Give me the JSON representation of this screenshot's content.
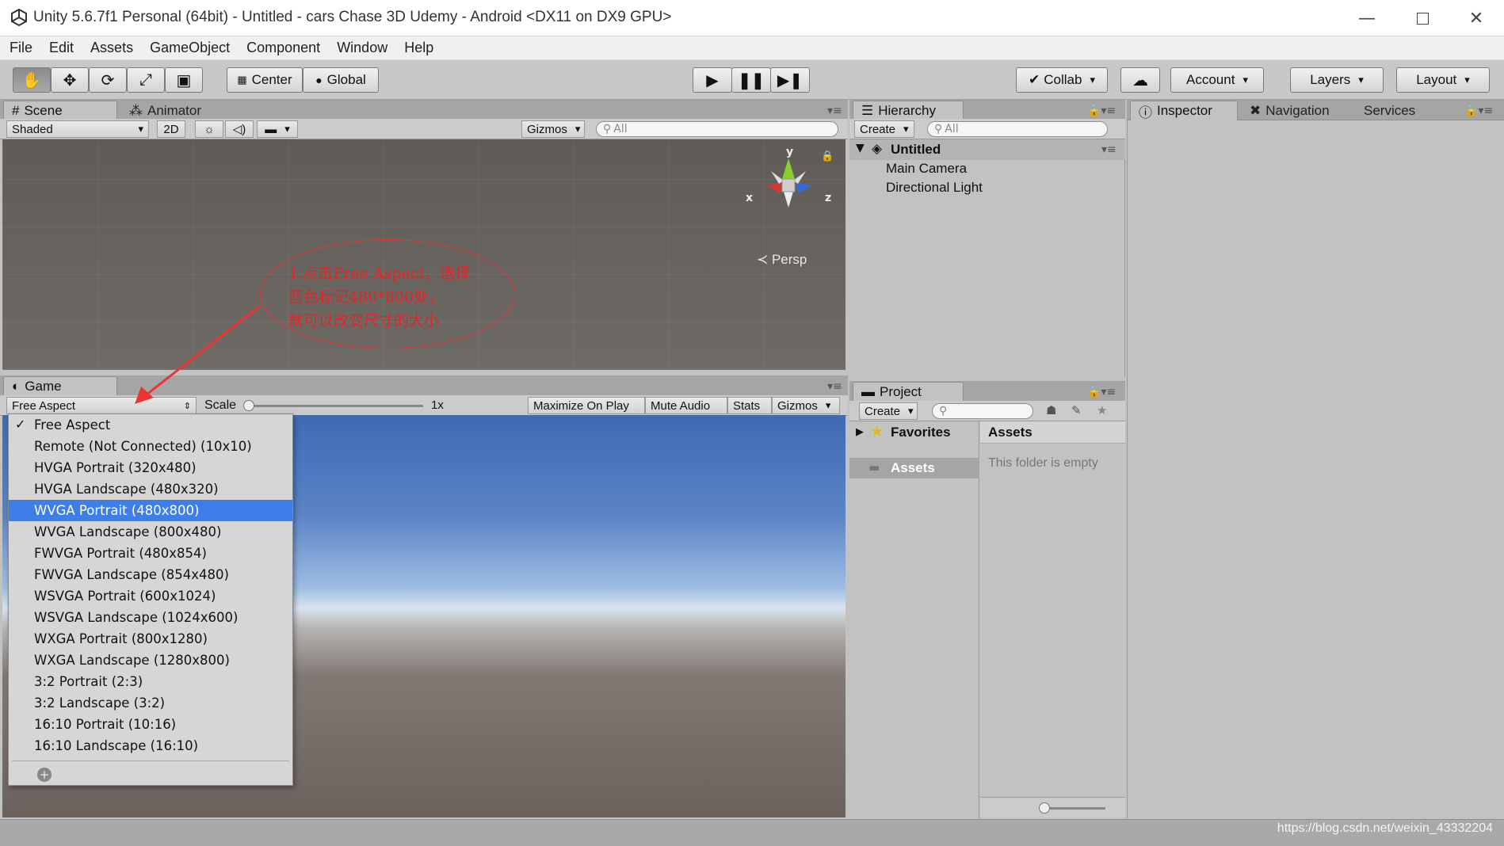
{
  "window": {
    "title": "Unity 5.6.7f1 Personal (64bit) - Untitled - cars Chase 3D Udemy - Android <DX11 on DX9 GPU>",
    "controls": [
      "minimize",
      "maximize",
      "close"
    ]
  },
  "menu": [
    "File",
    "Edit",
    "Assets",
    "GameObject",
    "Component",
    "Window",
    "Help"
  ],
  "toolbar": {
    "transform_tools": [
      "hand-icon",
      "move-icon",
      "rotate-icon",
      "scale-icon",
      "rect-icon"
    ],
    "pivot": "Center",
    "space": "Global",
    "playback": [
      "play-icon",
      "pause-icon",
      "step-icon"
    ],
    "collab": "Collab",
    "account": "Account",
    "layers": "Layers",
    "layout": "Layout"
  },
  "scene": {
    "tabs": [
      "Scene",
      "Animator"
    ],
    "shading": "Shaded",
    "mode_2d": "2D",
    "gizmos": "Gizmos",
    "search_placeholder": "All",
    "axes": {
      "y": "y",
      "x": "x",
      "z": "z"
    },
    "projection": "Persp"
  },
  "annotation": {
    "line1": "1.点击Free Aspect，选择",
    "line2": "蓝色标记480*800处，",
    "line3": "就可以改变尺寸的大小"
  },
  "game": {
    "tab": "Game",
    "aspect": "Free Aspect",
    "scale_label": "Scale",
    "scale_value": "1x",
    "buttons": [
      "Maximize On Play",
      "Mute Audio",
      "Stats",
      "Gizmos"
    ],
    "aspect_options": [
      "Free Aspect",
      "Remote (Not Connected) (10x10)",
      "HVGA Portrait (320x480)",
      "HVGA Landscape (480x320)",
      "WVGA Portrait (480x800)",
      "WVGA Landscape (800x480)",
      "FWVGA Portrait (480x854)",
      "FWVGA Landscape (854x480)",
      "WSVGA Portrait (600x1024)",
      "WSVGA Landscape (1024x600)",
      "WXGA Portrait (800x1280)",
      "WXGA Landscape (1280x800)",
      "3:2 Portrait (2:3)",
      "3:2 Landscape (3:2)",
      "16:10 Portrait (10:16)",
      "16:10 Landscape (16:10)"
    ],
    "checked_option": "Free Aspect",
    "highlighted_option": "WVGA Portrait (480x800)"
  },
  "hierarchy": {
    "tab": "Hierarchy",
    "create": "Create",
    "search_placeholder": "All",
    "scene_name": "Untitled",
    "objects": [
      "Main Camera",
      "Directional Light"
    ]
  },
  "project": {
    "tab": "Project",
    "create": "Create",
    "favorites": "Favorites",
    "assets_folder": "Assets",
    "assets_header": "Assets",
    "empty_message": "This folder is empty"
  },
  "inspector": {
    "tabs": [
      "Inspector",
      "Navigation",
      "Services"
    ]
  },
  "watermark": "https://blog.csdn.net/weixin_43332204"
}
